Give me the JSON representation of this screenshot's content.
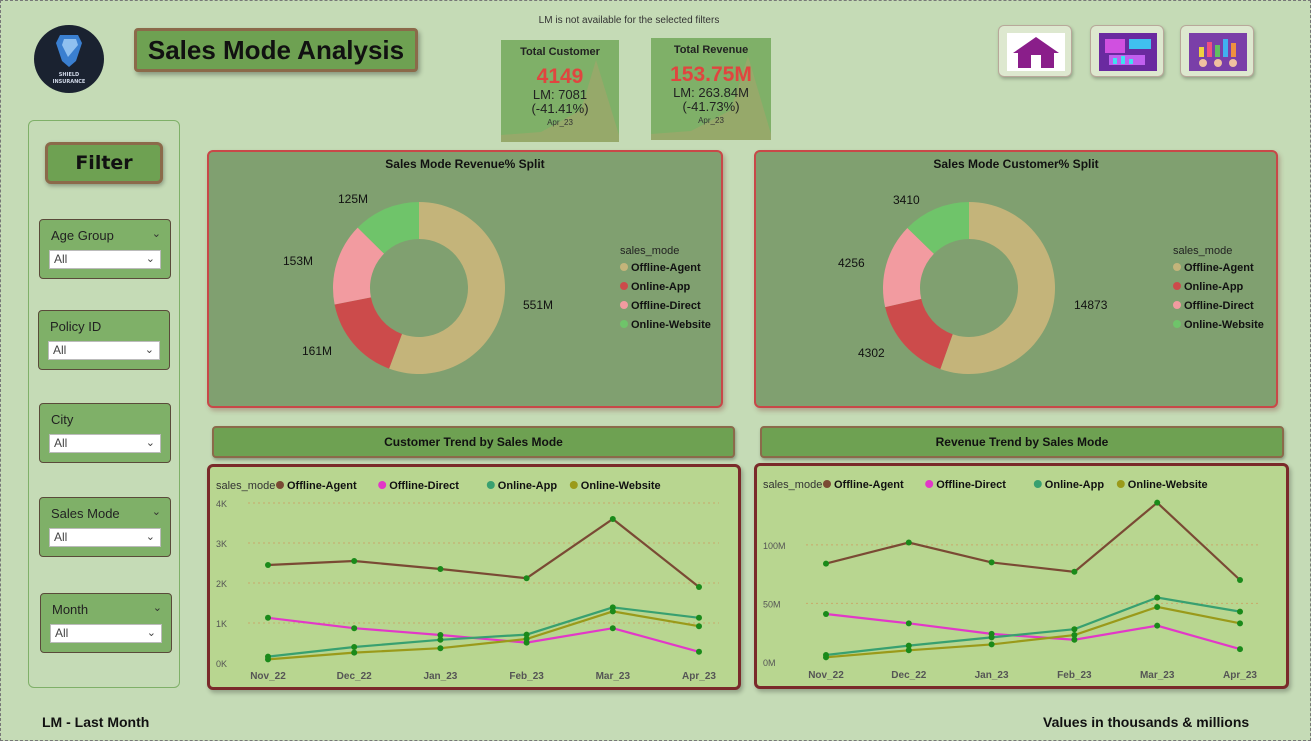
{
  "logo": {
    "line1": "SHIELD",
    "line2": "INSURANCE"
  },
  "title": "Sales Mode Analysis",
  "lm_note": "LM is not available for the selected filters",
  "kpis": [
    {
      "label": "Total Customer",
      "value": "4149",
      "lm": "LM: 7081",
      "pct": "(-41.41%)",
      "month": "Apr_23"
    },
    {
      "label": "Total Revenue",
      "value": "153.75M",
      "lm": "LM: 263.84M",
      "pct": "(-41.73%)",
      "month": "Apr_23"
    }
  ],
  "nav": [
    {
      "icon": "home-icon"
    },
    {
      "icon": "dashboard-screen-icon"
    },
    {
      "icon": "meeting-chart-icon"
    }
  ],
  "filter": {
    "header": "Filter",
    "slicers": [
      {
        "label": "Age Group",
        "value": "All"
      },
      {
        "label": "Policy ID",
        "value": "All"
      },
      {
        "label": "City",
        "value": "All"
      },
      {
        "label": "Sales Mode",
        "value": "All"
      },
      {
        "label": "Month",
        "value": "All"
      }
    ]
  },
  "colors": {
    "offline_agent": "#c4b47a",
    "online_app": "#cc4b4b",
    "offline_direct": "#f29ba0",
    "online_website": "#6fc46a",
    "line_offline_agent": "#7a4a34",
    "line_offline_direct": "#e238c8",
    "line_online_app": "#38a070",
    "line_online_website": "#9a9a1a"
  },
  "donuts": {
    "legend_title": "sales_mode",
    "legend": [
      "Offline-Agent",
      "Online-App",
      "Offline-Direct",
      "Online-Website"
    ]
  },
  "line_legend": {
    "title": "sales_mode",
    "items": [
      "Offline-Agent",
      "Offline-Direct",
      "Online-App",
      "Online-Website"
    ]
  },
  "chart_data": [
    {
      "type": "pie",
      "title": "Sales Mode Revenue% Split",
      "categories": [
        "Offline-Agent",
        "Online-App",
        "Offline-Direct",
        "Online-Website"
      ],
      "values": [
        551,
        161,
        153,
        125
      ],
      "labels": [
        "551M",
        "161M",
        "153M",
        "125M"
      ]
    },
    {
      "type": "pie",
      "title": "Sales Mode Customer% Split",
      "categories": [
        "Offline-Agent",
        "Online-App",
        "Offline-Direct",
        "Online-Website"
      ],
      "values": [
        14873,
        4302,
        4256,
        3410
      ],
      "labels": [
        "14873",
        "4302",
        "4256",
        "3410"
      ]
    },
    {
      "type": "line",
      "title": "Customer Trend by Sales Mode",
      "categories": [
        "Nov_22",
        "Dec_22",
        "Jan_23",
        "Feb_23",
        "Mar_23",
        "Apr_23"
      ],
      "ylim": [
        0,
        4000
      ],
      "yticks": [
        "0K",
        "1K",
        "2K",
        "3K",
        "4K"
      ],
      "series": [
        {
          "name": "Offline-Agent",
          "values": [
            2450,
            2550,
            2350,
            2120,
            3600,
            1900
          ]
        },
        {
          "name": "Offline-Direct",
          "values": [
            1130,
            870,
            700,
            510,
            870,
            280
          ]
        },
        {
          "name": "Online-App",
          "values": [
            160,
            400,
            580,
            710,
            1390,
            1130
          ]
        },
        {
          "name": "Online-Website",
          "values": [
            90,
            260,
            370,
            600,
            1290,
            920
          ]
        }
      ]
    },
    {
      "type": "line",
      "title": "Revenue Trend by Sales Mode",
      "categories": [
        "Nov_22",
        "Dec_22",
        "Jan_23",
        "Feb_23",
        "Mar_23",
        "Apr_23"
      ],
      "ylim": [
        0,
        140
      ],
      "yticks": [
        "0M",
        "50M",
        "100M"
      ],
      "series": [
        {
          "name": "Offline-Agent",
          "values": [
            84,
            102,
            85,
            77,
            136,
            70
          ]
        },
        {
          "name": "Offline-Direct",
          "values": [
            41,
            33,
            24,
            19,
            31,
            11
          ]
        },
        {
          "name": "Online-App",
          "values": [
            6,
            14,
            21,
            28,
            55,
            43
          ]
        },
        {
          "name": "Online-Website",
          "values": [
            4,
            10,
            15,
            23,
            47,
            33
          ]
        }
      ]
    }
  ],
  "footer": {
    "left": "LM - Last Month",
    "right": "Values in thousands & millions"
  }
}
